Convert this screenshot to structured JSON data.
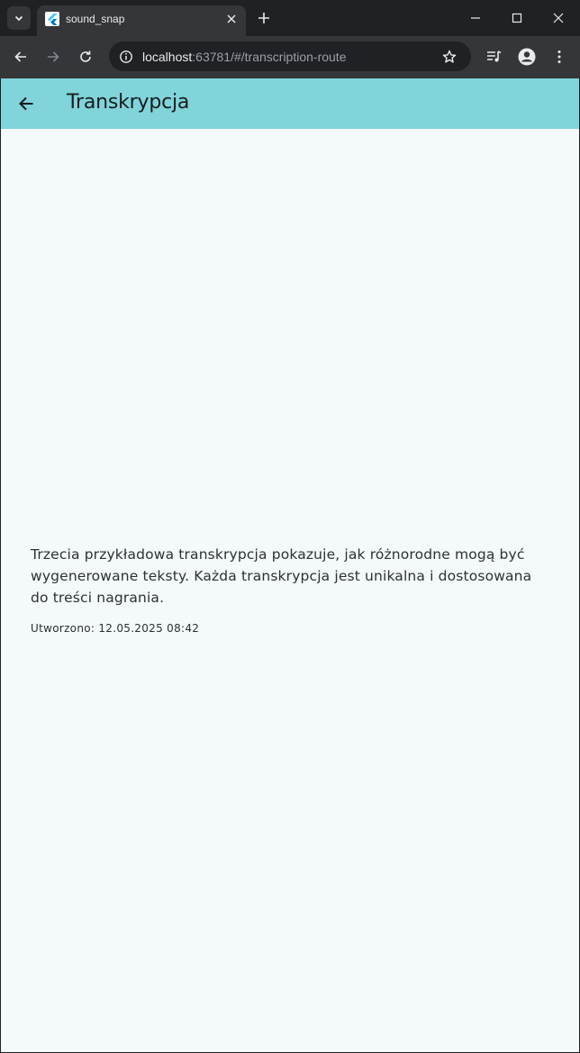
{
  "browser": {
    "tab_title": "sound_snap",
    "url_host": "localhost",
    "url_rest": ":63781/#/transcription-route",
    "icons": {
      "tab_search": "chevron-down-icon",
      "favicon": "flutter-icon",
      "close_tab": "close-icon",
      "new_tab": "plus-icon",
      "minimize": "minimize-icon",
      "maximize": "maximize-icon",
      "close_window": "close-icon",
      "back": "arrow-left-icon",
      "forward": "arrow-right-icon",
      "reload": "reload-icon",
      "site_info": "info-icon",
      "bookmark": "star-icon",
      "media": "media-queue-icon",
      "profile": "profile-icon",
      "menu": "kebab-menu-icon"
    }
  },
  "app": {
    "title": "Transkrypcja",
    "transcription_text": "Trzecia przykładowa transkrypcja pokazuje, jak różnorodne mogą być wygenerowane teksty. Każda transkrypcja jest unikalna i dostosowana do treści nagrania.",
    "created_label": "Utworzono:",
    "created_value": "12.05.2025 08:42",
    "colors": {
      "appbar": "#80d4da",
      "background": "#f4f9f9",
      "text": "#2a3232"
    }
  }
}
